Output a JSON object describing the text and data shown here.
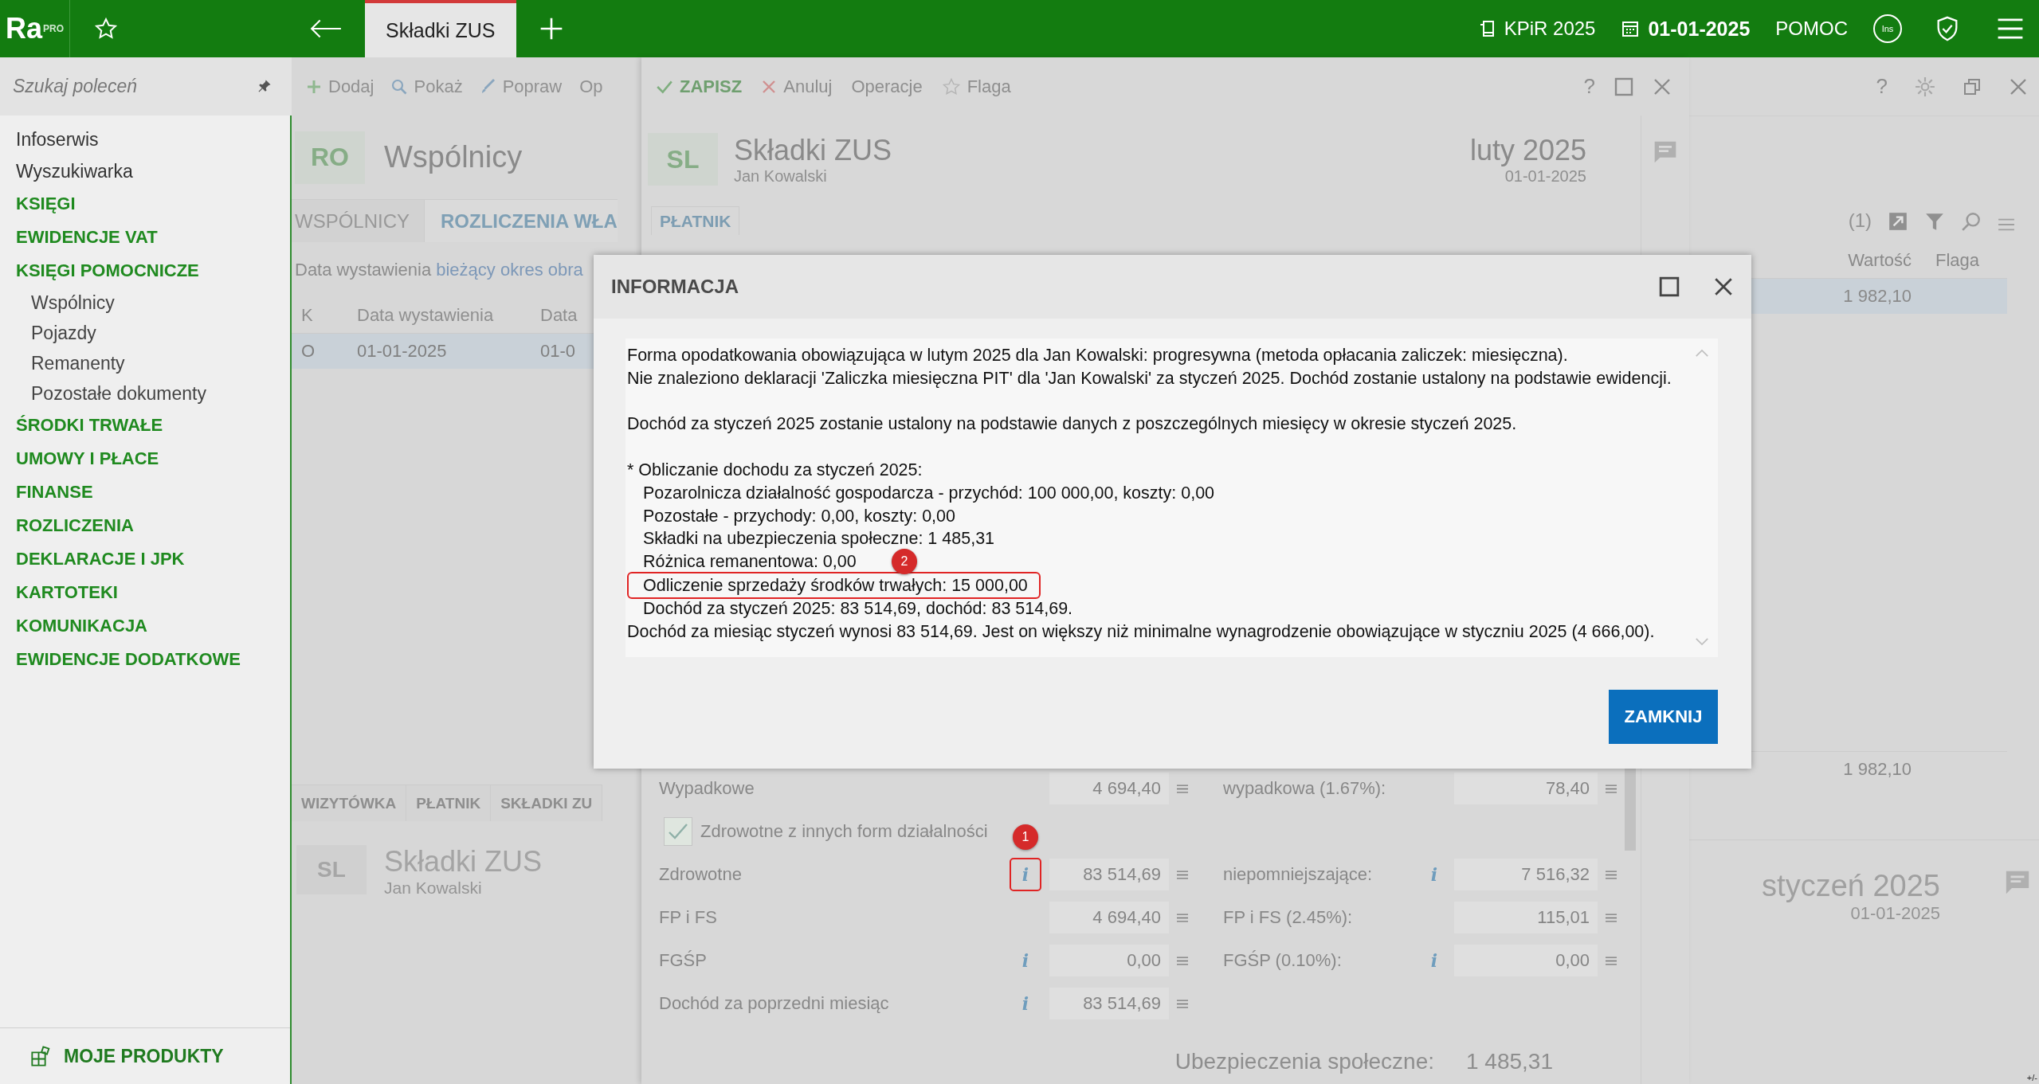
{
  "top_bar": {
    "logo": "Ra",
    "logo_badge": "PRO",
    "tabs": [
      {
        "label": "Składki ZUS",
        "selected": true
      }
    ],
    "book": "KPiR 2025",
    "date": "01-01-2025",
    "help": "POMOC",
    "ins_badge": "Ins"
  },
  "sidebar": {
    "search_placeholder": "Szukaj poleceń",
    "items": [
      {
        "label": "Infoserwis",
        "kind": "link"
      },
      {
        "label": "Wyszukiwarka",
        "kind": "link"
      },
      {
        "label": "KSIĘGI",
        "kind": "section"
      },
      {
        "label": "EWIDENCJE VAT",
        "kind": "section"
      },
      {
        "label": "KSIĘGI POMOCNICZE",
        "kind": "section",
        "children": [
          {
            "label": "Wspólnicy"
          },
          {
            "label": "Pojazdy"
          },
          {
            "label": "Remanenty"
          },
          {
            "label": "Pozostałe dokumenty"
          }
        ]
      },
      {
        "label": "ŚRODKI TRWAŁE",
        "kind": "section"
      },
      {
        "label": "UMOWY I PŁACE",
        "kind": "section"
      },
      {
        "label": "FINANSE",
        "kind": "section"
      },
      {
        "label": "ROZLICZENIA",
        "kind": "section"
      },
      {
        "label": "DEKLARACJE I JPK",
        "kind": "section"
      },
      {
        "label": "KARTOTEKI",
        "kind": "section"
      },
      {
        "label": "KOMUNIKACJA",
        "kind": "section"
      },
      {
        "label": "EWIDENCJE DODATKOWE",
        "kind": "section"
      }
    ],
    "footer": "MOJE PRODUKTY"
  },
  "list_window": {
    "toolbar": [
      {
        "label": "Dodaj",
        "kind": "add"
      },
      {
        "label": "Pokaż",
        "kind": "show"
      },
      {
        "label": "Popraw",
        "kind": "edit"
      },
      {
        "label": "Op",
        "kind": "plain"
      }
    ],
    "help": "?",
    "badge": "RO",
    "title": "Wspólnicy",
    "tabs": [
      {
        "label": "WSPÓLNICY",
        "selected": false
      },
      {
        "label": "ROZLICZENIA WŁA",
        "selected": true
      }
    ],
    "filter": {
      "label": "Data wystawienia",
      "value": "bieżący okres obra"
    },
    "count": "(1)",
    "columns": [
      "K",
      "Data wystawienia",
      "Data"
    ],
    "rows": [
      {
        "cells": [
          "O",
          "01-01-2025",
          "01-0"
        ],
        "selected": true
      }
    ],
    "right_columns": [
      "Wartość",
      "Flaga"
    ],
    "right_rows": [
      {
        "value": "1 982,10",
        "selected": true
      }
    ],
    "total": "1 982,10",
    "bottom_tabs": [
      "WIZYTÓWKA",
      "PŁATNIK",
      "SKŁADKI ZU"
    ],
    "preview": {
      "badge": "SL",
      "title": "Składki ZUS",
      "person": "Jan Kowalski",
      "period": "styczeń 2025",
      "date": "01-01-2025"
    },
    "corner": "+/-"
  },
  "edit_window": {
    "toolbar": [
      {
        "label": "ZAPISZ",
        "kind": "save"
      },
      {
        "label": "Anuluj",
        "kind": "cancel"
      },
      {
        "label": "Operacje",
        "kind": "plain"
      },
      {
        "label": "Flaga",
        "kind": "flag"
      }
    ],
    "help": "?",
    "badge": "SL",
    "title": "Składki ZUS",
    "person": "Jan Kowalski",
    "period": "luty 2025",
    "date": "01-01-2025",
    "tab": "PŁATNIK",
    "form": [
      {
        "kind": "field",
        "label": "Wypadkowe",
        "value": "4 694,40",
        "right": {
          "label": "wypadkowa (1.67%):",
          "value": "78,40"
        }
      },
      {
        "kind": "checkbox",
        "label": "Zdrowotne z innych form działalności",
        "checked": true
      },
      {
        "kind": "field",
        "label": "Zdrowotne",
        "info": "i",
        "marker": "1",
        "value": "83 514,69",
        "right": {
          "label": "niepomniejszające:",
          "info": "i",
          "value": "7 516,32"
        }
      },
      {
        "kind": "field",
        "label": "FP i FS",
        "value": "4 694,40",
        "right": {
          "label": "FP i FS (2.45%):",
          "value": "115,01"
        }
      },
      {
        "kind": "field",
        "label": "FGŚP",
        "info": "i",
        "value": "0,00",
        "right": {
          "label": "FGŚP (0.10%):",
          "info": "i",
          "value": "0,00"
        }
      },
      {
        "kind": "field",
        "label": "Dochód za poprzedni miesiąc",
        "info": "i",
        "value": "83 514,69"
      }
    ],
    "total": {
      "label": "Ubezpieczenia społeczne:",
      "value": "1 485,31"
    }
  },
  "dialog": {
    "title": "INFORMACJA",
    "paragraphs": [
      {
        "lines": [
          {
            "text": "Forma opodatkowania obowiązująca w lutym 2025 dla Jan Kowalski: progresywna (metoda opłacania zaliczek: miesięczna)."
          },
          {
            "text": "Nie znaleziono deklaracji 'Zaliczka miesięczna PIT' dla 'Jan Kowalski' za styczeń 2025. Dochód zostanie ustalony na podstawie ewidencji."
          }
        ]
      },
      {
        "lines": [
          {
            "text": "Dochód za styczeń 2025 zostanie ustalony na podstawie danych z poszczególnych miesięcy w okresie styczeń 2025."
          }
        ]
      },
      {
        "lines": [
          {
            "text": "* Obliczanie dochodu za styczeń 2025:",
            "children": [
              {
                "text": "Pozarolnicza działalność gospodarcza - przychód: 100 000,00, koszty: 0,00"
              },
              {
                "text": "Pozostałe - przychody: 0,00, koszty: 0,00"
              },
              {
                "text": "Składki na ubezpieczenia społeczne: 1 485,31"
              },
              {
                "text": "Różnica remanentowa: 0,00"
              },
              {
                "text": "Odliczenie sprzedaży środków trwałych: 15 000,00",
                "marker": "2"
              },
              {
                "text": "Dochód za styczeń 2025: 83 514,69, dochód: 83 514,69."
              }
            ]
          },
          {
            "text": "Dochód za miesiąc styczeń wynosi 83 514,69. Jest on większy niż minimalne wynagrodzenie obowiązujące w styczniu 2025 (4 666,00)."
          }
        ]
      }
    ],
    "button": "ZAMKNIJ"
  }
}
